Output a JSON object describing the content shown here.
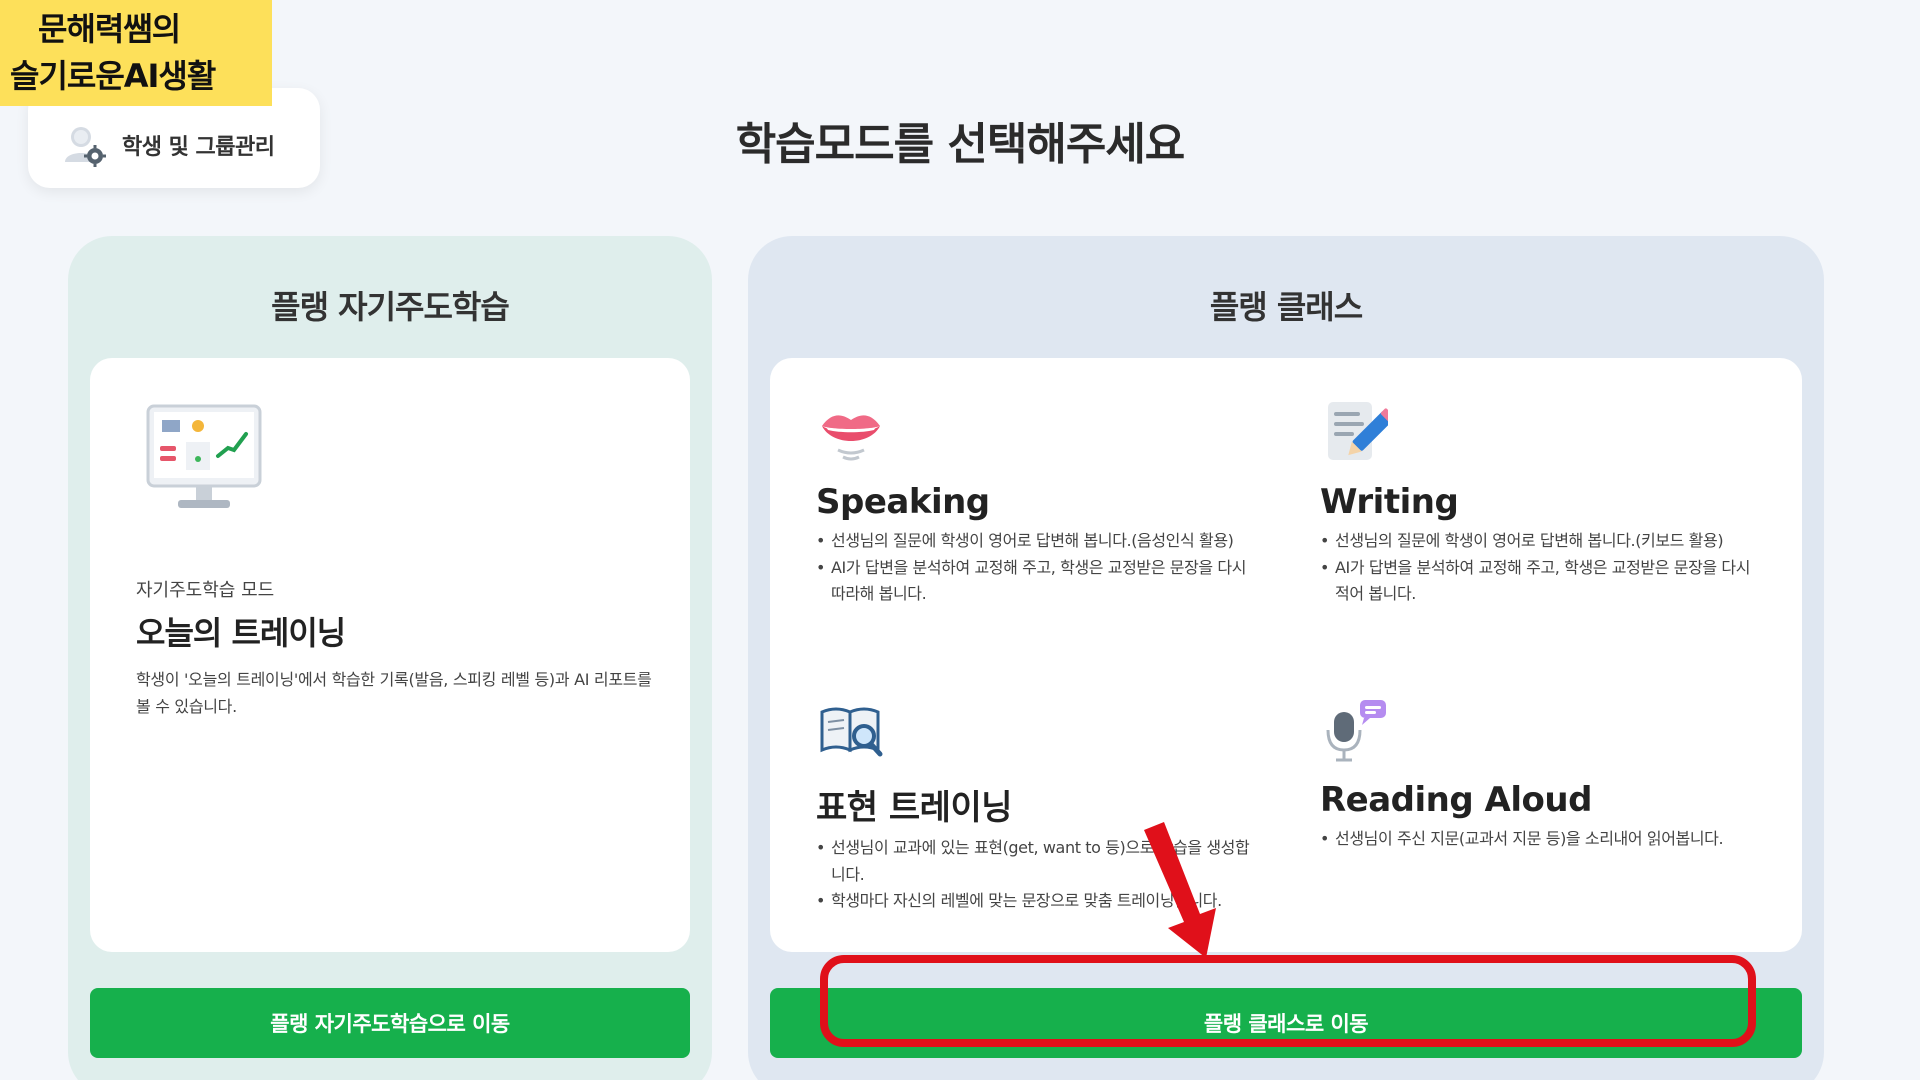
{
  "watermark": {
    "line1": "문해력쌤의",
    "line2": "슬기로운AI생활"
  },
  "manage": {
    "label": "학생 및 그룹관리"
  },
  "page_title": "학습모드를 선택해주세요",
  "left_panel": {
    "title": "플랭 자기주도학습",
    "mode_sub": "자기주도학습 모드",
    "mode_title": "오늘의 트레이닝",
    "mode_desc": "학생이 '오늘의 트레이닝'에서 학습한 기록(발음, 스피킹 레벨 등)과 AI 리포트를 볼 수 있습니다.",
    "button": "플랭 자기주도학습으로 이동"
  },
  "right_panel": {
    "title": "플랭 클래스",
    "features": [
      {
        "name": "Speaking",
        "icon": "lips-icon",
        "bullets": [
          "선생님의 질문에 학생이 영어로 답변해 봅니다.(음성인식 활용)",
          "AI가 답변을 분석하여 교정해 주고, 학생은 교정받은 문장을 다시 따라해 봅니다."
        ]
      },
      {
        "name": "Writing",
        "icon": "pencil-document-icon",
        "bullets": [
          "선생님의 질문에 학생이 영어로 답변해 봅니다.(키보드 활용)",
          "AI가 답변을 분석하여 교정해 주고, 학생은 교정받은 문장을 다시 적어 봅니다."
        ]
      },
      {
        "name": "표현 트레이닝",
        "icon": "book-magnifier-icon",
        "bullets": [
          "선생님이 교과에 있는 표현(get, want to 등)으로 학습을 생성합니다.",
          "학생마다 자신의 레벨에 맞는 문장으로 맞춤 트레이닝합니다."
        ]
      },
      {
        "name": "Reading Aloud",
        "icon": "microphone-icon",
        "bullets": [
          "선생님이 주신 지문(교과서 지문 등)을 소리내어 읽어봅니다."
        ]
      }
    ],
    "button": "플랭 클래스로 이동"
  },
  "colors": {
    "accent_green": "#16b04c",
    "highlight_red": "#e0101a",
    "watermark_yellow": "#fde05a"
  }
}
